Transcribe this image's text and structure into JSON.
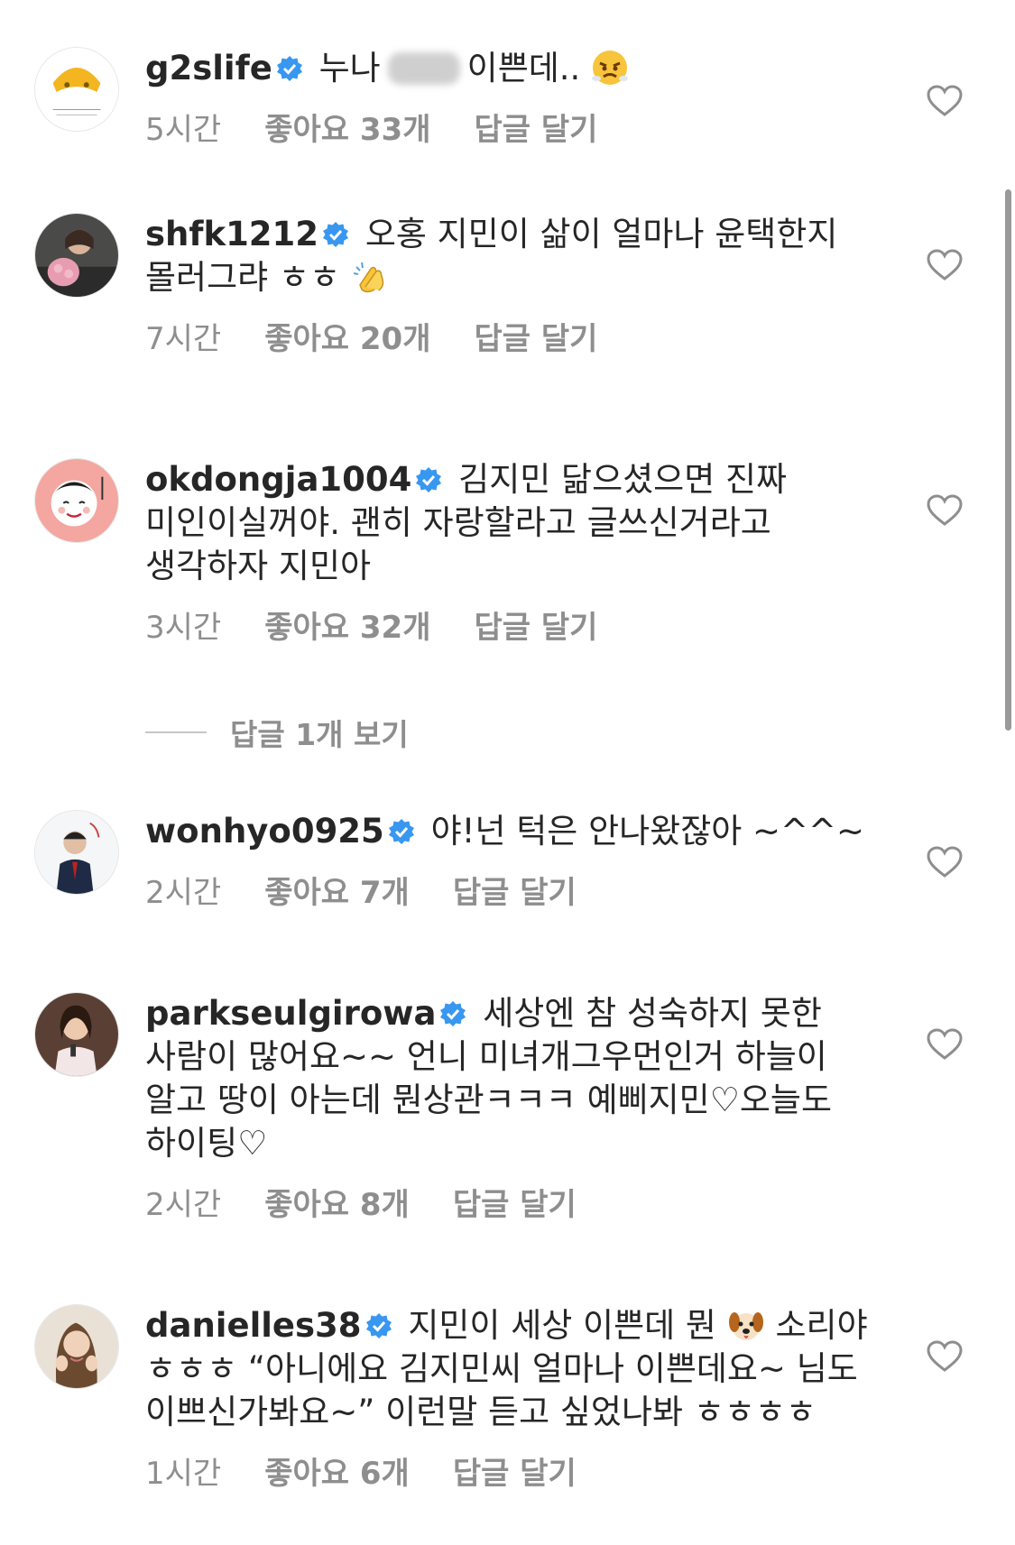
{
  "comments": [
    {
      "username": "g2slife",
      "text_before": "누나",
      "text_after": "이쁜데..",
      "emoji": "pouting-face-emoji",
      "time": "5시간",
      "likes": "좋아요 33개",
      "reply": "답글 달기"
    },
    {
      "username": "shfk1212",
      "text": "오홍 지민이 삶이 얼마나 윤택한지 몰러그랴 ㅎㅎ",
      "emoji": "clapping-hands-emoji",
      "time": "7시간",
      "likes": "좋아요 20개",
      "reply": "답글 달기"
    },
    {
      "username": "okdongja1004",
      "text": "김지민 닮으셨으면 진짜 미인이실꺼야. 괜히 자랑할라고 글쓰신거라고 생각하자 지민아",
      "time": "3시간",
      "likes": "좋아요 32개",
      "reply": "답글 달기"
    },
    {
      "username": "wonhyo0925",
      "text": "야!넌 턱은 안나왔잖아 ~^^~",
      "time": "2시간",
      "likes": "좋아요 7개",
      "reply": "답글 달기"
    },
    {
      "username": "parkseulgirowa",
      "text": "세상엔 참 성숙하지 못한 사람이 많어요~~ 언니 미녀개그우먼인거 하늘이 알고 땅이 아는데 뭔상관ㅋㅋㅋ 예삐지민♡오늘도 하이팅♡",
      "time": "2시간",
      "likes": "좋아요 8개",
      "reply": "답글 달기"
    },
    {
      "username": "danielles38",
      "text_before": "지민이 세상 이쁜데 뭔",
      "text_after": "소리야 ㅎㅎㅎ “아니에요 김지민씨 얼마나 이쁜데요~ 님도 이쁘신가봐요~” 이런말 듣고 싶었나봐 ㅎㅎㅎㅎ",
      "emoji": "dog-face-emoji",
      "time": "1시간",
      "likes": "좋아요 6개",
      "reply": "답글 달기"
    }
  ],
  "view_replies": "답글 1개 보기",
  "colors": {
    "verified": "#3897f0",
    "meta": "#8e8e8e",
    "text": "#262626"
  }
}
